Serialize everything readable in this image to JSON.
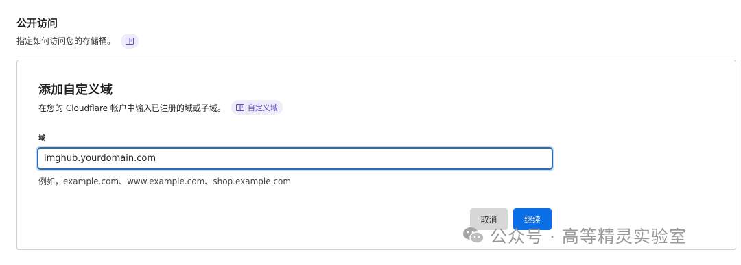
{
  "section": {
    "title": "公开访问",
    "description": "指定如何访问您的存储桶。"
  },
  "dialog": {
    "title": "添加自定义域",
    "description": "在您的 Cloudflare 帐户中输入已注册的域或子域。",
    "docs_link_label": "自定义域",
    "field_label": "域",
    "input_value": "imghub.yourdomain.com",
    "hint": "例如，example.com、www.example.com、shop.example.com",
    "cancel_label": "取消",
    "continue_label": "继续"
  },
  "watermark": {
    "text": "公众号 · 高等精灵实验室"
  },
  "icons": [
    "book-icon",
    "wechat-logo"
  ],
  "colors": {
    "primary": "#0a6ee6",
    "input_focus_border": "#2c6cb0",
    "chip_bg": "#eeecf6",
    "chip_text": "#5b4fc7"
  }
}
